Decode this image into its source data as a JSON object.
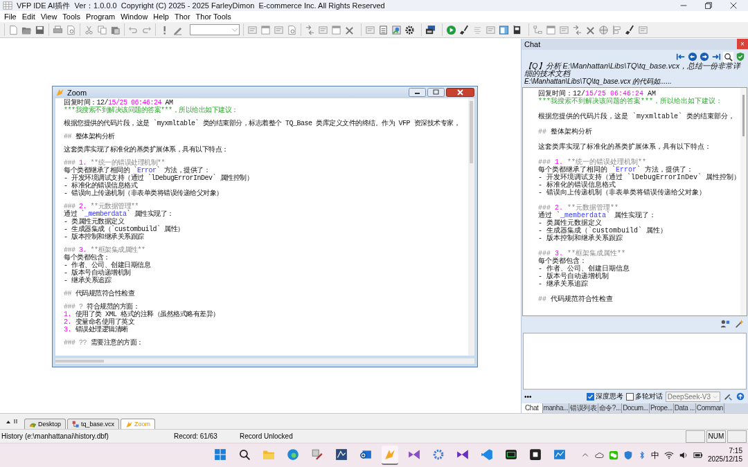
{
  "window": {
    "title": "VFP IDE AI插件  Ver：1.0.0.0  Copyright (C) 2025 - 2025 FarleyDimon  E-commerce Inc. All Rights Reserved"
  },
  "menu": [
    "File",
    "Edit",
    "View",
    "Tools",
    "Program",
    "Window",
    "Help",
    "Thor",
    "Thor Tools"
  ],
  "zoom_window": {
    "title": "Zoom",
    "lines": [
      {
        "gap_before": false,
        "parts": [
          {
            "kind": "plain",
            "text": "回复时间：12/"
          },
          {
            "kind": "number",
            "text": "15/25 06:46:24"
          },
          {
            "kind": "plain",
            "text": " AM"
          }
        ]
      },
      {
        "gap_before": false,
        "parts": [
          {
            "kind": "green",
            "text": "***我搜索不到解决该问题的答案***，所以给出如下建议："
          }
        ]
      },
      {
        "gap_before": true,
        "parts": [
          {
            "kind": "plain",
            "text": "根据您提供的代码片段，这是 `myxmltable` 类的结束部分，标志着整个 TQ_Base 类库定义文件的终结。作为 VFP 资深技术专家，"
          }
        ]
      },
      {
        "gap_before": true,
        "parts": [
          {
            "kind": "muted",
            "text": "## "
          },
          {
            "kind": "plain",
            "text": "整体架构分析"
          }
        ]
      },
      {
        "gap_before": true,
        "parts": [
          {
            "kind": "plain",
            "text": "这套类库实现了标准化的基类扩展体系，具有以下特点："
          }
        ]
      },
      {
        "gap_before": true,
        "parts": [
          {
            "kind": "muted",
            "text": "### "
          },
          {
            "kind": "number",
            "text": "1."
          },
          {
            "kind": "muted",
            "text": " **统一的错误处理机制**"
          }
        ]
      },
      {
        "gap_before": false,
        "parts": [
          {
            "kind": "plain",
            "text": "每个类都继承了相同的 `"
          },
          {
            "kind": "code",
            "text": "Error"
          },
          {
            "kind": "plain",
            "text": "` 方法，提供了："
          }
        ]
      },
      {
        "gap_before": false,
        "parts": [
          {
            "kind": "plain",
            "text": "- 开发环境调试支持（通过 `lDebugErrorInDev` 属性控制）"
          }
        ]
      },
      {
        "gap_before": false,
        "parts": [
          {
            "kind": "plain",
            "text": "- 标准化的错误信息格式"
          }
        ]
      },
      {
        "gap_before": false,
        "parts": [
          {
            "kind": "plain",
            "text": "- 错误向上传递机制（非表单类将错误传递给父对象）"
          }
        ]
      },
      {
        "gap_before": true,
        "parts": [
          {
            "kind": "muted",
            "text": "### "
          },
          {
            "kind": "number",
            "text": "2."
          },
          {
            "kind": "muted",
            "text": " **元数据管理**"
          }
        ]
      },
      {
        "gap_before": false,
        "parts": [
          {
            "kind": "plain",
            "text": "通过 `"
          },
          {
            "kind": "code",
            "text": "_memberdata"
          },
          {
            "kind": "plain",
            "text": "` 属性实现了："
          }
        ]
      },
      {
        "gap_before": false,
        "parts": [
          {
            "kind": "plain",
            "text": "- 类属性元数据定义"
          }
        ]
      },
      {
        "gap_before": false,
        "parts": [
          {
            "kind": "plain",
            "text": "- 生成器集成（`custombuild` 属性）"
          }
        ]
      },
      {
        "gap_before": false,
        "parts": [
          {
            "kind": "plain",
            "text": "- 版本控制和继承关系跟踪"
          }
        ]
      },
      {
        "gap_before": true,
        "parts": [
          {
            "kind": "muted",
            "text": "### "
          },
          {
            "kind": "number",
            "text": "3."
          },
          {
            "kind": "muted",
            "text": " **框架集成属性**"
          }
        ]
      },
      {
        "gap_before": false,
        "parts": [
          {
            "kind": "plain",
            "text": "每个类都包含："
          }
        ]
      },
      {
        "gap_before": false,
        "parts": [
          {
            "kind": "plain",
            "text": "- 作者、公司、创建日期信息"
          }
        ]
      },
      {
        "gap_before": false,
        "parts": [
          {
            "kind": "plain",
            "text": "- 版本号自动递增机制"
          }
        ]
      },
      {
        "gap_before": false,
        "parts": [
          {
            "kind": "plain",
            "text": "- 继承关系追踪"
          }
        ]
      },
      {
        "gap_before": true,
        "parts": [
          {
            "kind": "muted",
            "text": "## "
          },
          {
            "kind": "plain",
            "text": "代码规范符合性检查"
          }
        ]
      },
      {
        "gap_before": true,
        "parts": [
          {
            "kind": "muted",
            "text": "### ? "
          },
          {
            "kind": "plain",
            "text": "符合规范的方面："
          }
        ]
      },
      {
        "gap_before": false,
        "parts": [
          {
            "kind": "number",
            "text": "1."
          },
          {
            "kind": "plain",
            "text": " 使用了类 XML 格式的注释（虽然格式略有差异）"
          }
        ]
      },
      {
        "gap_before": false,
        "parts": [
          {
            "kind": "number",
            "text": "2."
          },
          {
            "kind": "plain",
            "text": " 变量命名使用了英文"
          }
        ]
      },
      {
        "gap_before": false,
        "parts": [
          {
            "kind": "number",
            "text": "3."
          },
          {
            "kind": "plain",
            "text": " 错误处理逻辑清晰"
          }
        ]
      },
      {
        "gap_before": true,
        "parts": [
          {
            "kind": "muted",
            "text": "### ?? "
          },
          {
            "kind": "plain",
            "text": "需要注意的方面："
          }
        ]
      }
    ]
  },
  "chat": {
    "title": "Chat",
    "close": "×",
    "question": "【Q】分析 E:\\Manhattan\\Libs\\TQ\\tq_base.vcx，总结一份非常详细的技术文档",
    "question_code": "E:\\Manhattan\\Libs\\TQ\\tq_base.vcx 的代码如......",
    "lines": [
      {
        "gap_before": false,
        "parts": [
          {
            "kind": "plain",
            "text": "回复时间：12/"
          },
          {
            "kind": "number",
            "text": "15/25 06:46:24"
          },
          {
            "kind": "plain",
            "text": " AM"
          }
        ]
      },
      {
        "gap_before": false,
        "parts": [
          {
            "kind": "green",
            "text": "***我搜索不到解决该问题的答案***，所以给出如下建议："
          }
        ]
      },
      {
        "gap_before": true,
        "parts": [
          {
            "kind": "plain",
            "text": "根据您提供的代码片段，这是 `myxmltable` 类的结束部分，"
          }
        ]
      },
      {
        "gap_before": true,
        "parts": [
          {
            "kind": "muted",
            "text": "## "
          },
          {
            "kind": "plain",
            "text": "整体架构分析"
          }
        ]
      },
      {
        "gap_before": true,
        "parts": [
          {
            "kind": "plain",
            "text": "这套类库实现了标准化的基类扩展体系，具有以下特点："
          }
        ]
      },
      {
        "gap_before": true,
        "parts": [
          {
            "kind": "muted",
            "text": "### "
          },
          {
            "kind": "number",
            "text": "1."
          },
          {
            "kind": "muted",
            "text": " **统一的错误处理机制**"
          }
        ]
      },
      {
        "gap_before": false,
        "parts": [
          {
            "kind": "plain",
            "text": "每个类都继承了相同的 `"
          },
          {
            "kind": "code",
            "text": "Error"
          },
          {
            "kind": "plain",
            "text": "` 方法，提供了："
          }
        ]
      },
      {
        "gap_before": false,
        "parts": [
          {
            "kind": "plain",
            "text": "- 开发环境调试支持（通过 `lDebugErrorInDev` 属性控制）"
          }
        ]
      },
      {
        "gap_before": false,
        "parts": [
          {
            "kind": "plain",
            "text": "- 标准化的错误信息格式"
          }
        ]
      },
      {
        "gap_before": false,
        "parts": [
          {
            "kind": "plain",
            "text": "- 错误向上传递机制（非表单类将错误传递给父对象）"
          }
        ]
      },
      {
        "gap_before": true,
        "parts": [
          {
            "kind": "muted",
            "text": "### "
          },
          {
            "kind": "number",
            "text": "2."
          },
          {
            "kind": "muted",
            "text": " **元数据管理**"
          }
        ]
      },
      {
        "gap_before": false,
        "parts": [
          {
            "kind": "plain",
            "text": "通过 `"
          },
          {
            "kind": "code",
            "text": "_memberdata"
          },
          {
            "kind": "plain",
            "text": "` 属性实现了："
          }
        ]
      },
      {
        "gap_before": false,
        "parts": [
          {
            "kind": "plain",
            "text": "- 类属性元数据定义"
          }
        ]
      },
      {
        "gap_before": false,
        "parts": [
          {
            "kind": "plain",
            "text": "- 生成器集成（`custombuild` 属性）"
          }
        ]
      },
      {
        "gap_before": false,
        "parts": [
          {
            "kind": "plain",
            "text": "- 版本控制和继承关系跟踪"
          }
        ]
      },
      {
        "gap_before": true,
        "parts": [
          {
            "kind": "muted",
            "text": "### "
          },
          {
            "kind": "number",
            "text": "3."
          },
          {
            "kind": "muted",
            "text": " **框架集成属性**"
          }
        ]
      },
      {
        "gap_before": false,
        "parts": [
          {
            "kind": "plain",
            "text": "每个类都包含："
          }
        ]
      },
      {
        "gap_before": false,
        "parts": [
          {
            "kind": "plain",
            "text": "- 作者、公司、创建日期信息"
          }
        ]
      },
      {
        "gap_before": false,
        "parts": [
          {
            "kind": "plain",
            "text": "- 版本号自动递增机制"
          }
        ]
      },
      {
        "gap_before": false,
        "parts": [
          {
            "kind": "plain",
            "text": "- 继承关系追踪"
          }
        ]
      },
      {
        "gap_before": true,
        "parts": [
          {
            "kind": "muted",
            "text": "## "
          },
          {
            "kind": "plain",
            "text": "代码规范符合性检查"
          }
        ]
      }
    ],
    "more": "•••",
    "options": [
      {
        "label": "深度思考",
        "checked": true
      },
      {
        "label": "多轮对话",
        "checked": false
      }
    ],
    "model": "DeepSeek-V3",
    "tabs": [
      {
        "label": "Chat",
        "selected": true
      },
      {
        "label": "manha...",
        "selected": false
      },
      {
        "label": "错误列表",
        "selected": false
      },
      {
        "label": "命令?...",
        "selected": false
      },
      {
        "label": "Docum...",
        "selected": false
      },
      {
        "label": "Prope...",
        "selected": false
      },
      {
        "label": "Data ...",
        "selected": false
      },
      {
        "label": "Comman",
        "selected": false
      }
    ]
  },
  "doc_tabs": [
    {
      "label": "Desktop",
      "selected": false
    },
    {
      "label": "tq_base.vcx",
      "selected": false
    },
    {
      "label": "Zoom",
      "selected": true
    }
  ],
  "status_bar": {
    "source": "History (e:\\manhattanai\\history.dbf)",
    "record": "Record: 61/63",
    "lock": "Record Unlocked",
    "num": "NUM"
  },
  "taskbar": {
    "ime": "中",
    "time": "7:15",
    "date": "2025/12/15"
  }
}
